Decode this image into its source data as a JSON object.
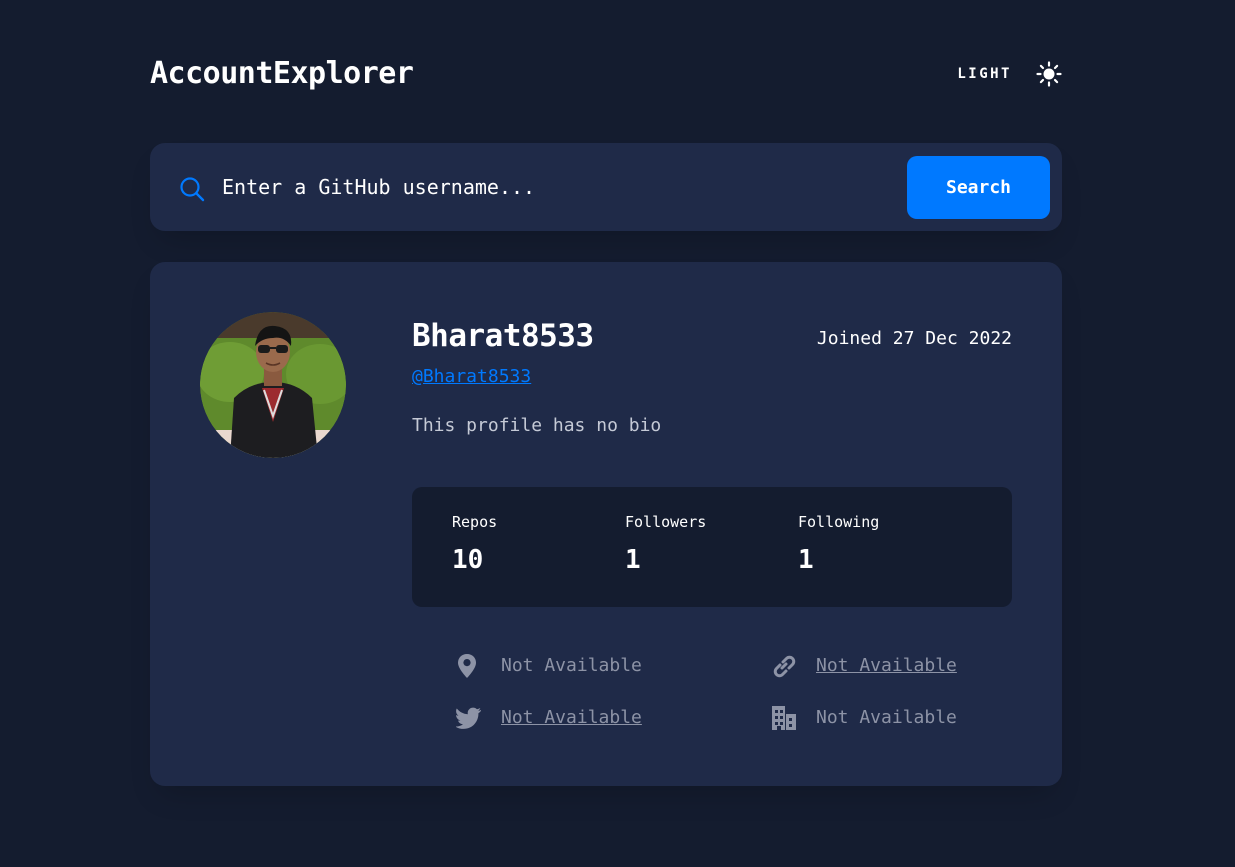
{
  "header": {
    "app_title": "AccountExplorer",
    "theme_label": "LIGHT",
    "theme_icon": "sun-icon"
  },
  "search": {
    "placeholder": "Enter a GitHub username...",
    "value": "",
    "button_label": "Search",
    "icon": "search-icon"
  },
  "profile": {
    "name": "Bharat8533",
    "login": "@Bharat8533",
    "joined": "Joined 27 Dec 2022",
    "bio": "This profile has no bio",
    "stats": [
      {
        "label": "Repos",
        "value": "10"
      },
      {
        "label": "Followers",
        "value": "1"
      },
      {
        "label": "Following",
        "value": "1"
      }
    ],
    "links": {
      "location": {
        "text": "Not Available",
        "icon": "location-pin-icon"
      },
      "website": {
        "text": "Not Available",
        "icon": "link-icon"
      },
      "twitter": {
        "text": "Not Available",
        "icon": "twitter-icon"
      },
      "company": {
        "text": "Not Available",
        "icon": "building-icon"
      }
    }
  },
  "colors": {
    "background": "#141c2f",
    "card": "#1f2a48",
    "accent": "#0079ff",
    "muted_text": "#8d93a6"
  }
}
